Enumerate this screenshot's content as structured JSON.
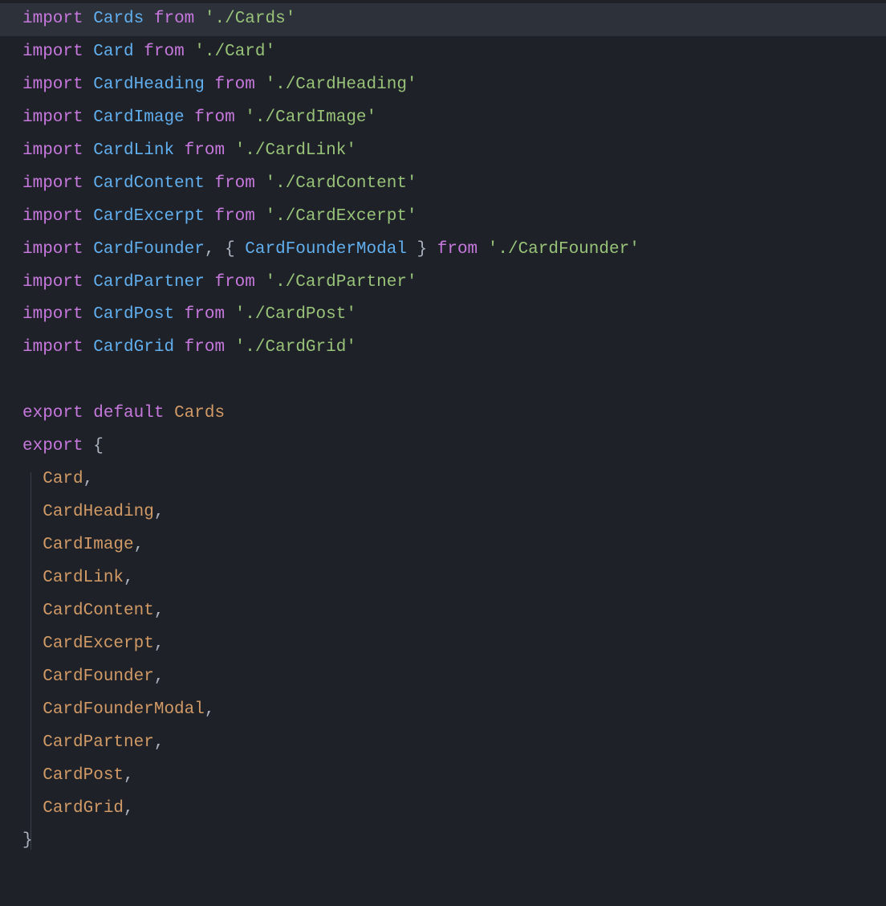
{
  "lines": [
    {
      "highlighted": true,
      "tokens": [
        {
          "cls": "keyword",
          "text": "import"
        },
        {
          "cls": "punct",
          "text": " "
        },
        {
          "cls": "type",
          "text": "Cards"
        },
        {
          "cls": "punct",
          "text": " "
        },
        {
          "cls": "keyword",
          "text": "from"
        },
        {
          "cls": "punct",
          "text": " "
        },
        {
          "cls": "string",
          "text": "'./Cards'"
        }
      ]
    },
    {
      "tokens": [
        {
          "cls": "keyword",
          "text": "import"
        },
        {
          "cls": "punct",
          "text": " "
        },
        {
          "cls": "type",
          "text": "Card"
        },
        {
          "cls": "punct",
          "text": " "
        },
        {
          "cls": "keyword",
          "text": "from"
        },
        {
          "cls": "punct",
          "text": " "
        },
        {
          "cls": "string",
          "text": "'./Card'"
        }
      ]
    },
    {
      "tokens": [
        {
          "cls": "keyword",
          "text": "import"
        },
        {
          "cls": "punct",
          "text": " "
        },
        {
          "cls": "type",
          "text": "CardHeading"
        },
        {
          "cls": "punct",
          "text": " "
        },
        {
          "cls": "keyword",
          "text": "from"
        },
        {
          "cls": "punct",
          "text": " "
        },
        {
          "cls": "string",
          "text": "'./CardHeading'"
        }
      ]
    },
    {
      "tokens": [
        {
          "cls": "keyword",
          "text": "import"
        },
        {
          "cls": "punct",
          "text": " "
        },
        {
          "cls": "type",
          "text": "CardImage"
        },
        {
          "cls": "punct",
          "text": " "
        },
        {
          "cls": "keyword",
          "text": "from"
        },
        {
          "cls": "punct",
          "text": " "
        },
        {
          "cls": "string",
          "text": "'./CardImage'"
        }
      ]
    },
    {
      "tokens": [
        {
          "cls": "keyword",
          "text": "import"
        },
        {
          "cls": "punct",
          "text": " "
        },
        {
          "cls": "type",
          "text": "CardLink"
        },
        {
          "cls": "punct",
          "text": " "
        },
        {
          "cls": "keyword",
          "text": "from"
        },
        {
          "cls": "punct",
          "text": " "
        },
        {
          "cls": "string",
          "text": "'./CardLink'"
        }
      ]
    },
    {
      "tokens": [
        {
          "cls": "keyword",
          "text": "import"
        },
        {
          "cls": "punct",
          "text": " "
        },
        {
          "cls": "type",
          "text": "CardContent"
        },
        {
          "cls": "punct",
          "text": " "
        },
        {
          "cls": "keyword",
          "text": "from"
        },
        {
          "cls": "punct",
          "text": " "
        },
        {
          "cls": "string",
          "text": "'./CardContent'"
        }
      ]
    },
    {
      "tokens": [
        {
          "cls": "keyword",
          "text": "import"
        },
        {
          "cls": "punct",
          "text": " "
        },
        {
          "cls": "type",
          "text": "CardExcerpt"
        },
        {
          "cls": "punct",
          "text": " "
        },
        {
          "cls": "keyword",
          "text": "from"
        },
        {
          "cls": "punct",
          "text": " "
        },
        {
          "cls": "string",
          "text": "'./CardExcerpt'"
        }
      ]
    },
    {
      "tokens": [
        {
          "cls": "keyword",
          "text": "import"
        },
        {
          "cls": "punct",
          "text": " "
        },
        {
          "cls": "type",
          "text": "CardFounder"
        },
        {
          "cls": "punct",
          "text": ", { "
        },
        {
          "cls": "type",
          "text": "CardFounderModal"
        },
        {
          "cls": "punct",
          "text": " } "
        },
        {
          "cls": "keyword",
          "text": "from"
        },
        {
          "cls": "punct",
          "text": " "
        },
        {
          "cls": "string",
          "text": "'./CardFounder'"
        }
      ]
    },
    {
      "tokens": [
        {
          "cls": "keyword",
          "text": "import"
        },
        {
          "cls": "punct",
          "text": " "
        },
        {
          "cls": "type",
          "text": "CardPartner"
        },
        {
          "cls": "punct",
          "text": " "
        },
        {
          "cls": "keyword",
          "text": "from"
        },
        {
          "cls": "punct",
          "text": " "
        },
        {
          "cls": "string",
          "text": "'./CardPartner'"
        }
      ]
    },
    {
      "tokens": [
        {
          "cls": "keyword",
          "text": "import"
        },
        {
          "cls": "punct",
          "text": " "
        },
        {
          "cls": "type",
          "text": "CardPost"
        },
        {
          "cls": "punct",
          "text": " "
        },
        {
          "cls": "keyword",
          "text": "from"
        },
        {
          "cls": "punct",
          "text": " "
        },
        {
          "cls": "string",
          "text": "'./CardPost'"
        }
      ]
    },
    {
      "tokens": [
        {
          "cls": "keyword",
          "text": "import"
        },
        {
          "cls": "punct",
          "text": " "
        },
        {
          "cls": "type",
          "text": "CardGrid"
        },
        {
          "cls": "punct",
          "text": " "
        },
        {
          "cls": "keyword",
          "text": "from"
        },
        {
          "cls": "punct",
          "text": " "
        },
        {
          "cls": "string",
          "text": "'./CardGrid'"
        }
      ]
    },
    {
      "tokens": []
    },
    {
      "tokens": [
        {
          "cls": "keyword",
          "text": "export"
        },
        {
          "cls": "punct",
          "text": " "
        },
        {
          "cls": "keyword",
          "text": "default"
        },
        {
          "cls": "punct",
          "text": " "
        },
        {
          "cls": "orange",
          "text": "Cards"
        }
      ]
    },
    {
      "tokens": [
        {
          "cls": "keyword",
          "text": "export"
        },
        {
          "cls": "punct",
          "text": " {"
        }
      ]
    },
    {
      "tokens": [
        {
          "cls": "punct",
          "text": "  "
        },
        {
          "cls": "orange",
          "text": "Card"
        },
        {
          "cls": "punct",
          "text": ","
        }
      ]
    },
    {
      "tokens": [
        {
          "cls": "punct",
          "text": "  "
        },
        {
          "cls": "orange",
          "text": "CardHeading"
        },
        {
          "cls": "punct",
          "text": ","
        }
      ]
    },
    {
      "tokens": [
        {
          "cls": "punct",
          "text": "  "
        },
        {
          "cls": "orange",
          "text": "CardImage"
        },
        {
          "cls": "punct",
          "text": ","
        }
      ]
    },
    {
      "tokens": [
        {
          "cls": "punct",
          "text": "  "
        },
        {
          "cls": "orange",
          "text": "CardLink"
        },
        {
          "cls": "punct",
          "text": ","
        }
      ]
    },
    {
      "tokens": [
        {
          "cls": "punct",
          "text": "  "
        },
        {
          "cls": "orange",
          "text": "CardContent"
        },
        {
          "cls": "punct",
          "text": ","
        }
      ]
    },
    {
      "tokens": [
        {
          "cls": "punct",
          "text": "  "
        },
        {
          "cls": "orange",
          "text": "CardExcerpt"
        },
        {
          "cls": "punct",
          "text": ","
        }
      ]
    },
    {
      "tokens": [
        {
          "cls": "punct",
          "text": "  "
        },
        {
          "cls": "orange",
          "text": "CardFounder"
        },
        {
          "cls": "punct",
          "text": ","
        }
      ]
    },
    {
      "tokens": [
        {
          "cls": "punct",
          "text": "  "
        },
        {
          "cls": "orange",
          "text": "CardFounderModal"
        },
        {
          "cls": "punct",
          "text": ","
        }
      ]
    },
    {
      "tokens": [
        {
          "cls": "punct",
          "text": "  "
        },
        {
          "cls": "orange",
          "text": "CardPartner"
        },
        {
          "cls": "punct",
          "text": ","
        }
      ]
    },
    {
      "tokens": [
        {
          "cls": "punct",
          "text": "  "
        },
        {
          "cls": "orange",
          "text": "CardPost"
        },
        {
          "cls": "punct",
          "text": ","
        }
      ]
    },
    {
      "tokens": [
        {
          "cls": "punct",
          "text": "  "
        },
        {
          "cls": "orange",
          "text": "CardGrid"
        },
        {
          "cls": "punct",
          "text": ","
        }
      ]
    },
    {
      "tokens": [
        {
          "cls": "punct",
          "text": "}"
        }
      ]
    }
  ]
}
